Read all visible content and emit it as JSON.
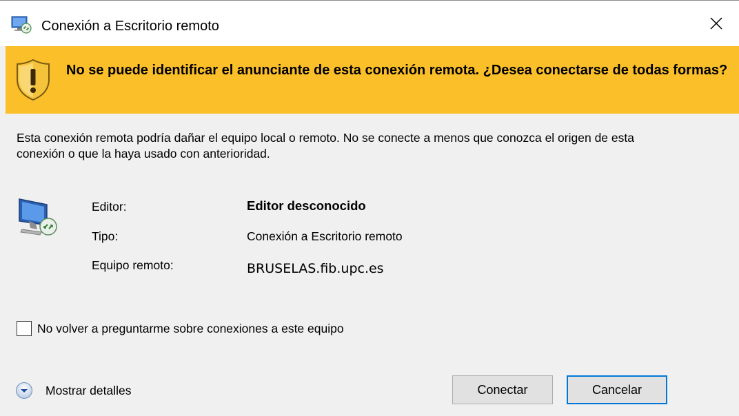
{
  "window": {
    "title": "Conexión a Escritorio remoto"
  },
  "banner": {
    "message": "No se puede identificar el anunciante de esta conexión remota. ¿Desea conectarse de todas formas?",
    "icon": "warning-shield-icon",
    "color": "#fbbf2a"
  },
  "body": {
    "description": "Esta conexión remota podría dañar el equipo local o remoto. No se conecte a menos que conozca el origen de esta conexión o que la haya usado con anterioridad."
  },
  "details": {
    "editor_label": "Editor:",
    "editor_value": "Editor desconocido",
    "type_label": "Tipo:",
    "type_value": "Conexión a Escritorio remoto",
    "computer_label": "Equipo remoto:",
    "computer_value": "BRUSELAS.fib.upc.es"
  },
  "options": {
    "dont_ask_label": "No volver a preguntarme sobre conexiones a este equipo",
    "dont_ask_checked": false
  },
  "footer": {
    "show_details_label": "Mostrar detalles",
    "connect_label": "Conectar",
    "cancel_label": "Cancelar",
    "accent_color": "#0078d7"
  }
}
